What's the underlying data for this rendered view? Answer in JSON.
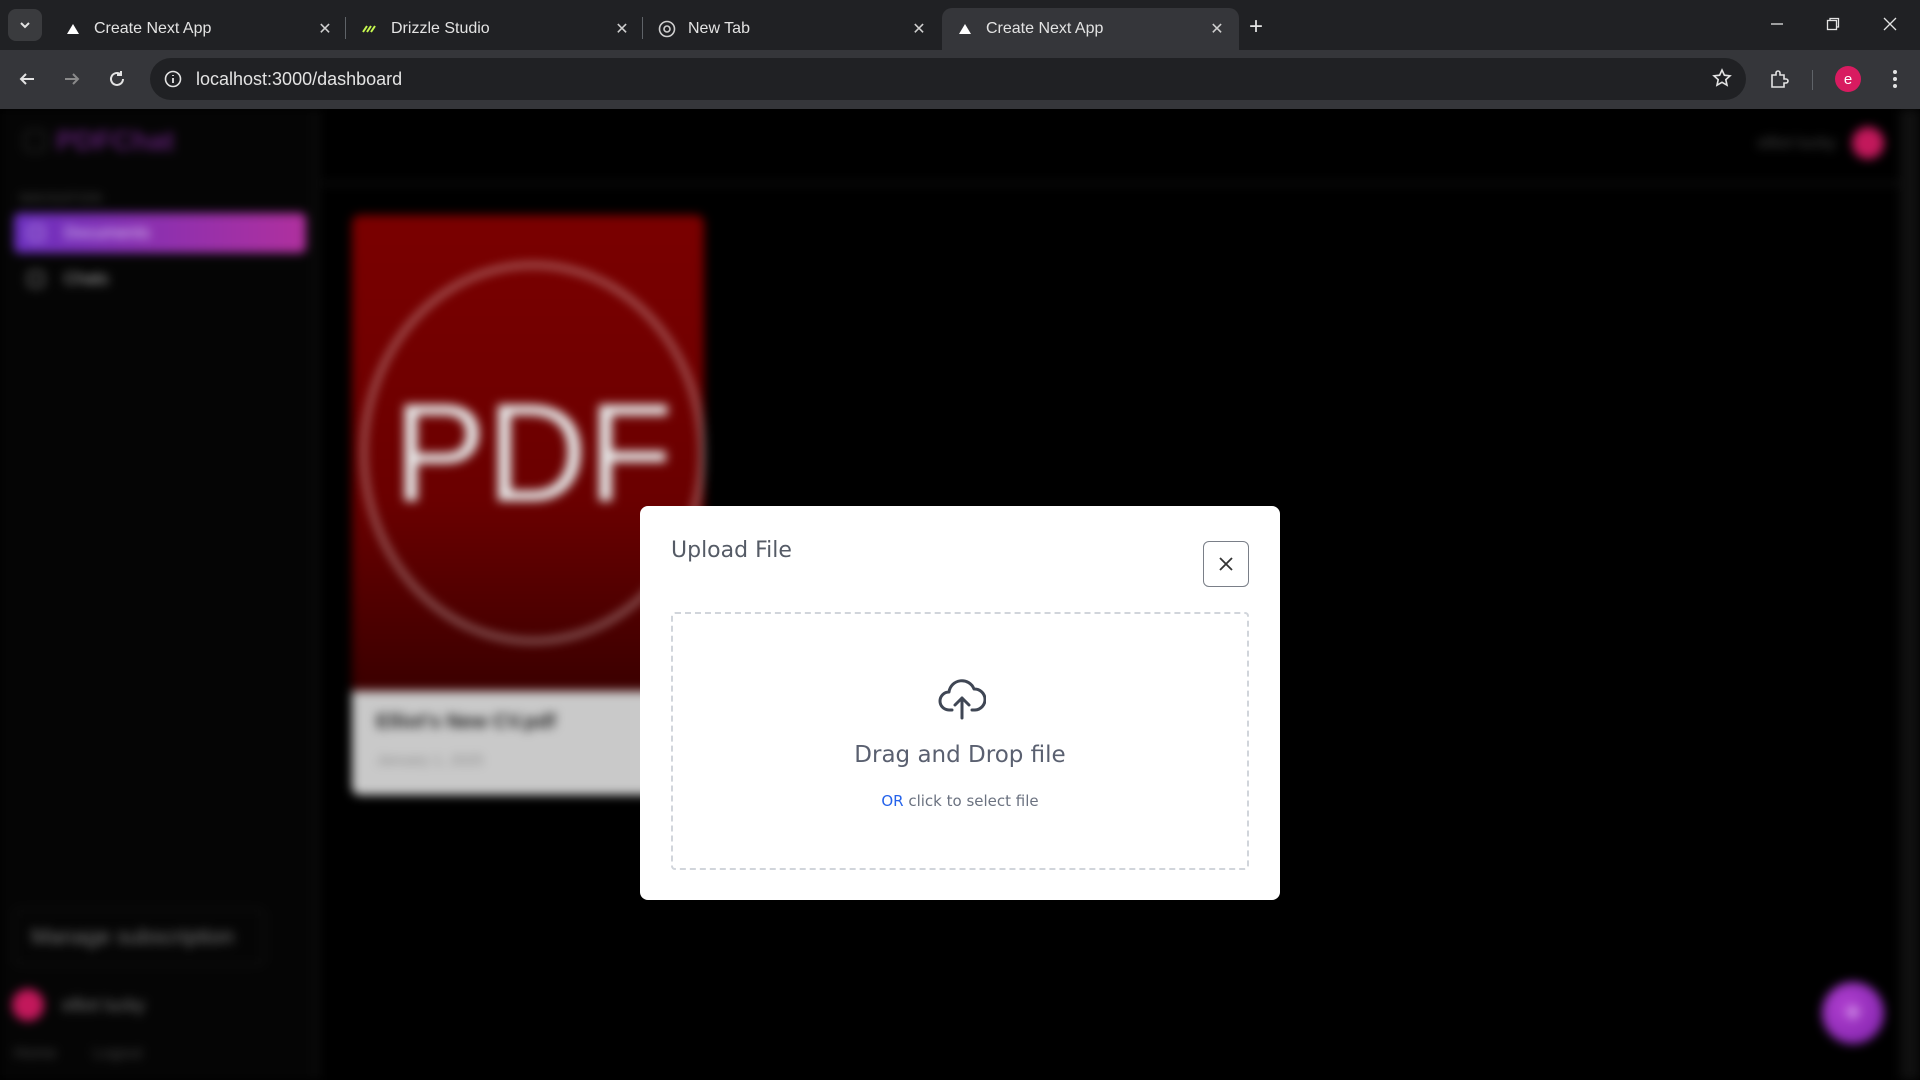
{
  "browser": {
    "tabs": [
      {
        "title": "Create Next App",
        "favicon": "vercel-triangle-icon",
        "active": false
      },
      {
        "title": "Drizzle Studio",
        "favicon": "drizzle-icon",
        "active": false
      },
      {
        "title": "New Tab",
        "favicon": "chrome-icon",
        "active": false
      },
      {
        "title": "Create Next App",
        "favicon": "vercel-triangle-icon",
        "active": true
      }
    ],
    "url": "localhost:3000/dashboard",
    "profile_initial": "e",
    "profile_color": "#d81b60"
  },
  "app": {
    "logo_text": "PDFChat",
    "nav_caption": "NAVIGATION",
    "nav": [
      {
        "label": "Documents",
        "active": true
      },
      {
        "label": "Chats",
        "active": false
      }
    ],
    "manage_subscription": "Manage subscription",
    "user_name": "elliot lucky",
    "footer_links": [
      "Home",
      "Logout"
    ],
    "document": {
      "thumb_text": "PDF",
      "title": "Elliot's New CV.pdf",
      "date": "January 1, 2025"
    },
    "fab_icon": "+",
    "accent_gradient": [
      "#6b2fbf",
      "#b0309e"
    ]
  },
  "modal": {
    "title": "Upload File",
    "dropzone": {
      "icon": "cloud-upload-icon",
      "title": "Drag and Drop file",
      "or_text": "OR",
      "sub_text": " click to select file"
    },
    "link_color": "#2563eb"
  }
}
